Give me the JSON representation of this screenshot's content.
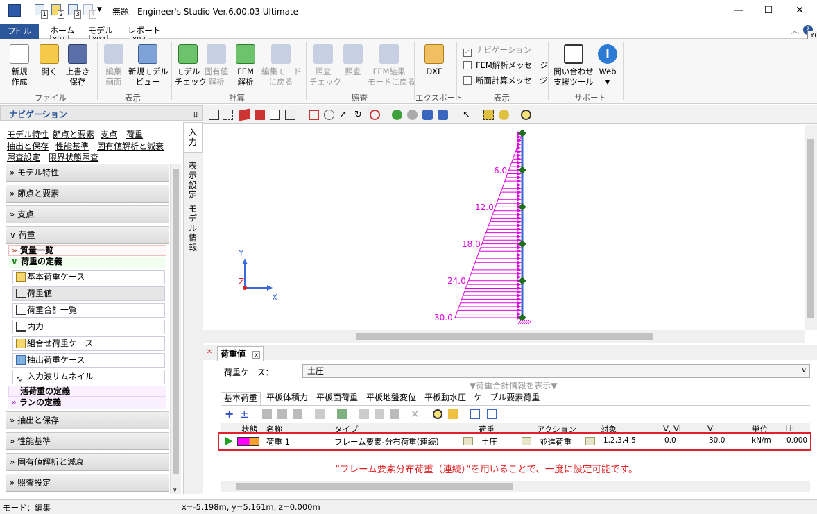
{
  "window": {
    "title": "無題 - Engineer's Studio Ver.6.00.03 Ultimate",
    "qat_keys": [
      "1",
      "2",
      "3",
      "4"
    ],
    "controls": {
      "minimize": "—",
      "maximize": "☐",
      "close": "✕"
    }
  },
  "tabs": {
    "file": "フF ル",
    "home": "ホーム",
    "model": "モデル",
    "report": "レポート",
    "home_key": "Y01",
    "model_key": "Y02",
    "report_key": "Y03",
    "right_key": "Y("
  },
  "ribbon": {
    "new_label": "新規\n作成",
    "open_label": "開く",
    "save_label": "上書き\n保存",
    "group_file": "ファイル",
    "edit_screen": "編集\n画面",
    "new_model_view": "新規モデル\nビュー",
    "group_view": "表示",
    "model_check": "モデル\nチェック",
    "eigen": "固有値\n解析",
    "fem": "FEM\n解析",
    "back_edit": "編集モード\nに戻る",
    "group_calc": "計算",
    "check_verify": "照査\nチェック",
    "verify": "照査",
    "back_fem": "FEM結果\nモードに戻る",
    "group_verify": "照査",
    "dxf": "DXF",
    "group_export": "エクスポート",
    "cb_nav": "ナビゲーション",
    "cb_fem_msg": "FEM解析メッセージ",
    "cb_section_msg": "断面計算メッセージ",
    "group_display": "表示",
    "support_tool": "問い合わせ\n支援ツール",
    "web": "Web",
    "group_support": "サポート"
  },
  "nav": {
    "title": "ナビゲーション",
    "pin": "ﾛ",
    "links": [
      "モデル特性",
      "節点と要素",
      "支点",
      "荷重",
      "抽出と保存",
      "性能基準",
      "固有値解析と減衰",
      "照査設定",
      "限界状態照査"
    ],
    "sections": {
      "model_props": "モデル特性",
      "nodes_elements": "節点と要素",
      "supports": "支点",
      "loads": "荷重",
      "extract_save": "抽出と保存",
      "perf_criteria": "性能基準",
      "eigen_damping": "固有値解析と減衰",
      "verify_setting": "照査設定"
    },
    "mass_list": "質量一覧",
    "load_def": "荷重の定義",
    "items": [
      "基本荷重ケース",
      "荷重値",
      "荷重合計一覧",
      "内力",
      "組合せ荷重ケース",
      "抽出荷重ケース",
      "入力波サムネイル"
    ],
    "live_load_def": "活荷重の定義",
    "lane_def": "ランの定義",
    "vtabs": [
      "入力",
      "表示設定",
      "モデル情報"
    ]
  },
  "viewport": {
    "load_values": [
      "6.0",
      "12.0",
      "18.0",
      "24.0",
      "30.0"
    ],
    "axis_y": "Y",
    "axis_z": "Z",
    "axis_x": "X"
  },
  "panel": {
    "title": "荷重値",
    "close": "x",
    "loadcase_label": "荷重ケース：",
    "loadcase_value": "土圧",
    "total_info": "▼荷重合計情報を表示▼",
    "subtabs": [
      "基本荷重",
      "平板体積力",
      "平板面荷重",
      "平板地盤変位",
      "平板動水圧",
      "ケーブル要素荷重"
    ],
    "columns": [
      "状態",
      "名称",
      "タイプ",
      "荷重",
      "アクション",
      "対象",
      "V, Vi",
      "Vj",
      "単位",
      "Li: (m)"
    ],
    "row": {
      "name": "荷重 1",
      "type": "フレーム要素-分布荷重(連続)",
      "load": "土圧",
      "action": "並進荷重",
      "target": "1,2,3,4,5",
      "vi": "0.0",
      "vj": "30.0",
      "unit": "kN/m",
      "li": "0.000"
    },
    "note": "”フレーム要素分布荷重（連続）”を用いることで、一度に設定可能です。"
  },
  "status": {
    "mode": "モード：編集",
    "coords": "x=-5.198m, y=5.161m, z=0.000m"
  },
  "colors": {
    "load": "#e000e0",
    "member": "#3a6ad8",
    "node": "#1d6e1d",
    "accent_blue": "#2b579a",
    "highlight": "#e0202a"
  }
}
